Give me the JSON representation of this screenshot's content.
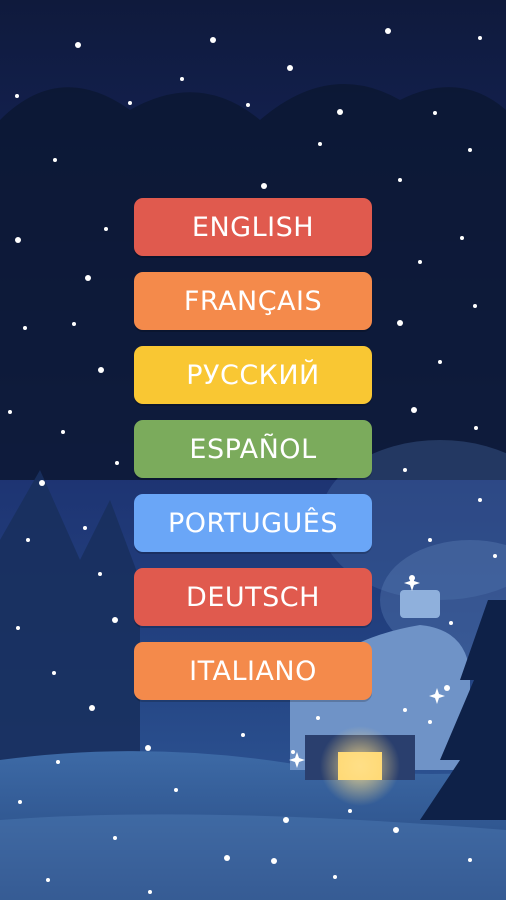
{
  "languages": [
    {
      "label": "ENGLISH",
      "color": "#e05a4e"
    },
    {
      "label": "FRANÇAIS",
      "color": "#f48a4b"
    },
    {
      "label": "РУССКИЙ",
      "color": "#f9c733"
    },
    {
      "label": "ESPAÑOL",
      "color": "#7bab5c"
    },
    {
      "label": "PORTUGUÊS",
      "color": "#6aa6f7"
    },
    {
      "label": "DEUTSCH",
      "color": "#e05a4e"
    },
    {
      "label": "ITALIANO",
      "color": "#f48a4b"
    }
  ],
  "colors": {
    "sky_top": "#0f1a3c",
    "sky_bottom": "#3a6aa5",
    "snow": "#ffffff",
    "window_glow": "#ffd66b"
  }
}
